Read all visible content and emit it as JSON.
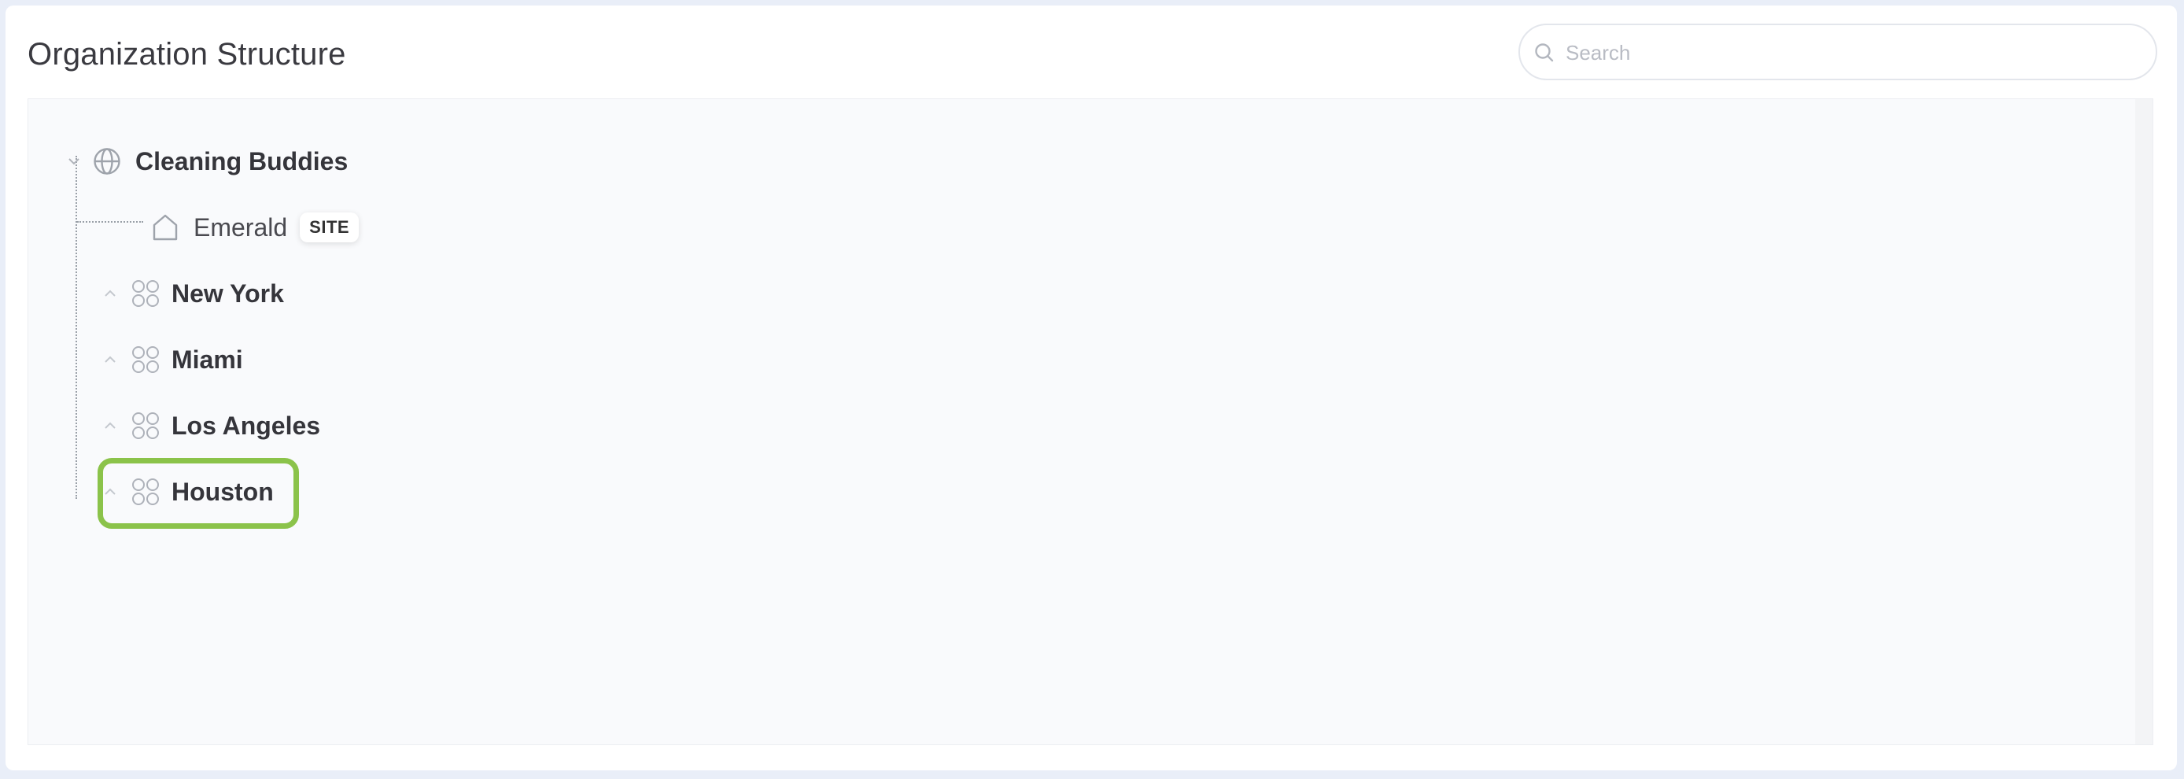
{
  "header": {
    "title": "Organization Structure"
  },
  "search": {
    "placeholder": "Search",
    "value": ""
  },
  "tree": {
    "root": {
      "label": "Cleaning Buddies",
      "icon": "globe-icon",
      "expanded": true
    },
    "site": {
      "label": "Emerald",
      "badge": "SITE",
      "icon": "home-icon"
    },
    "groups": [
      {
        "label": "New York",
        "icon": "group-icon",
        "expanded": false
      },
      {
        "label": "Miami",
        "icon": "group-icon",
        "expanded": false
      },
      {
        "label": "Los Angeles",
        "icon": "group-icon",
        "expanded": false
      },
      {
        "label": "Houston",
        "icon": "group-icon",
        "expanded": false
      }
    ]
  },
  "highlight": {
    "target": "Houston",
    "color": "#8bc34a"
  }
}
